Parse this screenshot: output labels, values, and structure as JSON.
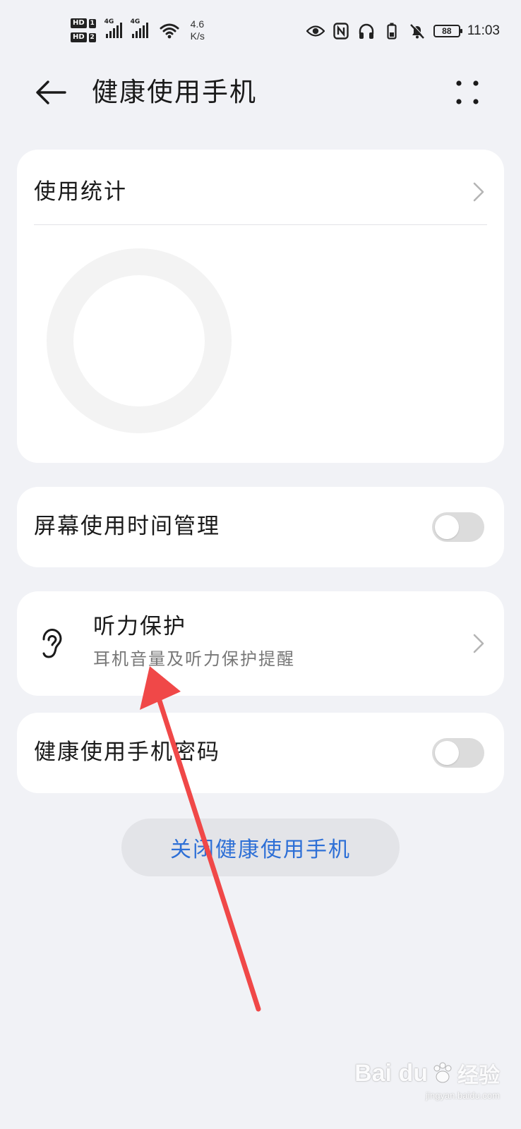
{
  "status_bar": {
    "sim1_label": "HD",
    "sim1_num": "1",
    "sim2_label": "HD",
    "sim2_num": "2",
    "net1": "4G",
    "net2": "4G",
    "speed_value": "4.6",
    "speed_unit": "K/s",
    "battery": "88",
    "time": "11:03",
    "icons": [
      "eye-icon",
      "nfc-icon",
      "headphones-icon",
      "battery-saver-icon",
      "bell-muted-icon"
    ]
  },
  "header": {
    "title": "健康使用手机",
    "back_icon": "arrow-left-icon",
    "more_icon": "more-dots-icon"
  },
  "usage_stats": {
    "title": "使用统计",
    "chevron_icon": "chevron-right-icon"
  },
  "screen_time": {
    "label": "屏幕使用时间管理",
    "enabled": false
  },
  "hearing": {
    "title": "听力保护",
    "subtitle": "耳机音量及听力保护提醒",
    "icon": "ear-icon"
  },
  "password": {
    "label": "健康使用手机密码",
    "enabled": false
  },
  "close_button": {
    "label": "关闭健康使用手机"
  },
  "colors": {
    "background": "#f1f2f6",
    "card": "#ffffff",
    "accent": "#2d6fd6",
    "annotation_arrow": "#f04848",
    "toggle_off": "#dcdcdc"
  },
  "watermark": {
    "brand": "Bai du",
    "jingyan": "经验",
    "url": "jingyan.baidu.com"
  }
}
